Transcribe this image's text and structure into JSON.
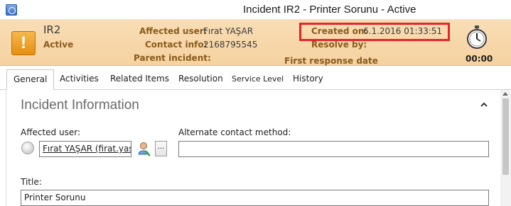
{
  "window": {
    "title": "Incident IR2 - Printer Sorunu - Active"
  },
  "header": {
    "id": "IR2",
    "status": "Active",
    "affected_user_label": "Affected user:",
    "affected_user_value": "Fırat YAŞAR",
    "contact_info_label": "Contact info:",
    "contact_info_value": "2168795545",
    "parent_incident_label": "Parent incident:",
    "created_on_label": "Created on:",
    "created_on_value": "6.1.2016 01:33:51",
    "resolve_by_label": "Resolve by:",
    "first_response_label": "First response date",
    "timer": "00:00",
    "highlight_color": "#e5252a"
  },
  "tabs": [
    {
      "label": "General"
    },
    {
      "label": "Activities"
    },
    {
      "label": "Related Items"
    },
    {
      "label": "Resolution"
    },
    {
      "label": "Service Level"
    },
    {
      "label": "History"
    }
  ],
  "form": {
    "section_title": "Incident Information",
    "affected_user_label": "Affected user:",
    "affected_user_value": "Fırat YAŞAR (firat.yasar)",
    "alternate_contact_label": "Alternate contact method:",
    "alternate_contact_value": "",
    "title_label": "Title:",
    "title_value": "Printer Sorunu",
    "ellipsis_label": "..."
  },
  "colors": {
    "header_background": "#f7d8ab",
    "header_label": "#8a5a1a",
    "warning_icon": "#e99a1e"
  }
}
